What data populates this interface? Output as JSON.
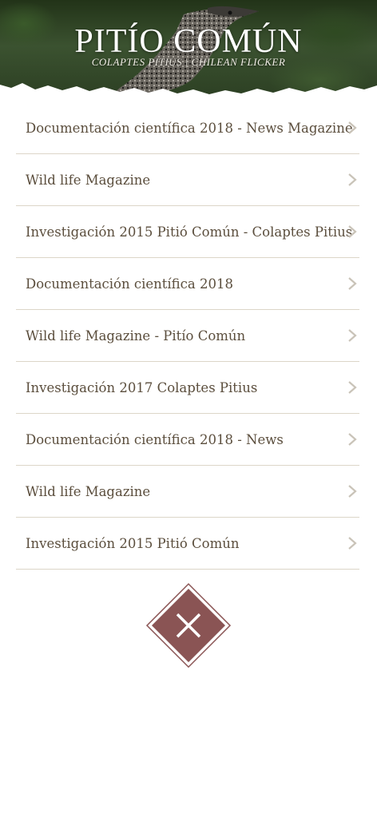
{
  "header": {
    "title": "PITÍO COMÚN",
    "subtitle": "COLAPTES PITIUS | CHILEAN FLICKER"
  },
  "items": [
    {
      "label": "Documentación científica 2018 - News Magazine"
    },
    {
      "label": "Wild life Magazine"
    },
    {
      "label": "Investigación 2015 Pitió Común - Colaptes Pitius"
    },
    {
      "label": "Documentación científica 2018"
    },
    {
      "label": "Wild life Magazine - Pitío Común"
    },
    {
      "label": "Investigación 2017 Colaptes Pitius"
    },
    {
      "label": "Documentación científica 2018 - News"
    },
    {
      "label": "Wild life Magazine"
    },
    {
      "label": "Investigación 2015 Pitió Común"
    }
  ],
  "icons": {
    "row_chevron": "chevron-right-icon",
    "close": "close-icon"
  },
  "colors": {
    "text": "#5b4e3d",
    "divider": "#dcd6c8",
    "chevron": "#c9c3b8",
    "close_fill": "#8a5454"
  }
}
